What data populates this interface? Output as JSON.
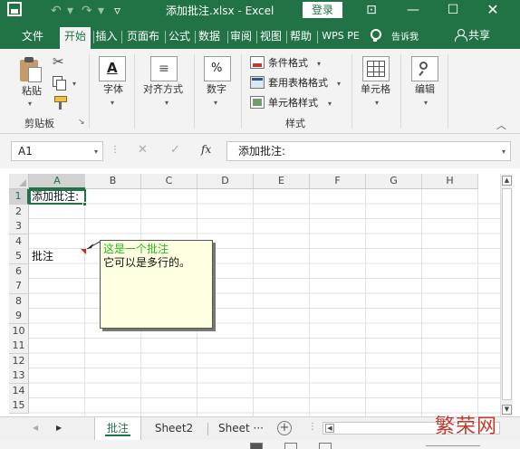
{
  "window": {
    "title": "添加批注.xlsx - Excel",
    "login_button": "登录",
    "theme_color": "#217346"
  },
  "quick_access": {
    "icons": [
      "save-icon",
      "undo-icon",
      "redo-icon",
      "customize-icon"
    ]
  },
  "ribbon_tabs": [
    {
      "label": "文件"
    },
    {
      "label": "开始",
      "active": true
    },
    {
      "label": "插入"
    },
    {
      "label": "页面布"
    },
    {
      "label": "公式"
    },
    {
      "label": "数据"
    },
    {
      "label": "审阅"
    },
    {
      "label": "视图"
    },
    {
      "label": "帮助"
    },
    {
      "label": "WPS PE"
    }
  ],
  "tell_me": {
    "label": "告诉我"
  },
  "share": {
    "label": "共享"
  },
  "ribbon": {
    "clipboard": {
      "paste": "粘贴",
      "group_label": "剪贴板",
      "launcher": "↘"
    },
    "font": {
      "icon_text": "A",
      "label": "字体"
    },
    "alignment": {
      "icon_text": "≡",
      "label": "对齐方式"
    },
    "number": {
      "icon_text": "%",
      "label": "数字"
    },
    "styles": {
      "conditional_formatting": "条件格式",
      "format_as_table": "套用表格格式",
      "cell_styles": "单元格样式",
      "group_label": "样式"
    },
    "cells": {
      "label": "单元格"
    },
    "editing": {
      "label": "编辑"
    }
  },
  "formula_bar": {
    "name_box": "A1",
    "content": "添加批注:"
  },
  "sheet": {
    "columns": [
      "A",
      "B",
      "C",
      "D",
      "E",
      "F",
      "G",
      "H"
    ],
    "selected_column": "A",
    "rows": [
      "1",
      "2",
      "3",
      "4",
      "5",
      "6",
      "7",
      "8",
      "9",
      "10",
      "11",
      "12",
      "13",
      "14",
      "15"
    ],
    "selected_row": "1",
    "active_cell": "A1",
    "cells": {
      "A1": "添加批注:",
      "A5": "批注"
    },
    "comment": {
      "cell": "A5",
      "author": "这是一个批注",
      "body": "它可以是多行的。",
      "author_color": "#22bb22",
      "fill_color": "#ffffe1",
      "indicator_color": "#e02020"
    }
  },
  "sheet_tabs": {
    "tabs": [
      {
        "label": "批注",
        "active": true
      },
      {
        "label": "Sheet2"
      },
      {
        "label": "Sheet"
      }
    ],
    "overflow": "···",
    "add_sheet": "+",
    "more": "⋮"
  },
  "watermark": {
    "text": "繁荣网"
  }
}
